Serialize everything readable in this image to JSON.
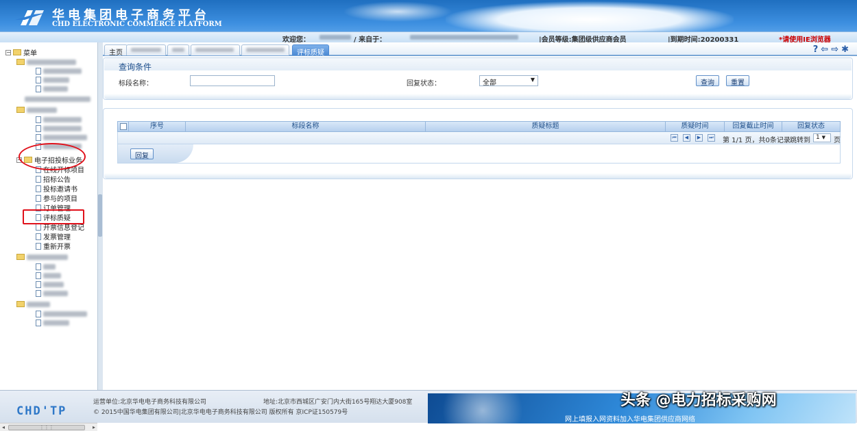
{
  "header": {
    "logo_cn": "华电集团电子商务平台",
    "logo_en": "CHD ELECTRONIC COMMERCE PLATFORM",
    "welcome_label": "欢迎您：",
    "from_label": "/   来自于：",
    "member_level": "|会员等级:集团级供应商会员",
    "expire": "|到期时间:20200331",
    "ie_hint": "*请使用IE浏览器"
  },
  "sidebar": {
    "root_label": "菜单",
    "group_label": "电子招投标业务",
    "items": [
      "在线开标项目",
      "招标公告",
      "投标邀请书",
      "参与的项目",
      "订单管理",
      "评标质疑",
      "开票信息登记",
      "发票管理",
      "重新开票"
    ]
  },
  "tabs": {
    "home": "主页",
    "active": "评标质疑"
  },
  "query": {
    "title": "查询条件",
    "section_label": "标段名称：",
    "section_value": "",
    "reply_status_label": "回复状态：",
    "reply_status_value": "全部",
    "search_button": "查询",
    "reset_button": "重置"
  },
  "grid": {
    "columns": [
      "序号",
      "标段名称",
      "质疑标题",
      "质疑时间",
      "回复截止时间",
      "回复状态"
    ],
    "rows": [],
    "pager": {
      "info": "第 1/1 页，共0条记录",
      "jump_label": "跳转到",
      "page_value": "1",
      "page_suffix": "页"
    },
    "reply_button": "回复"
  },
  "footer": {
    "logo": "CHD'TP",
    "operator": "运营单位:北京华电电子商务科技有限公司",
    "address": "地址:北京市西城区广安门内大街165号翔达大厦908室",
    "copyright": "© 2015中国华电集团有限公司|北京华电电子商务科技有限公司  版权所有  京ICP证150579号",
    "banner_text": "网上填报入网资料加入华电集团供应商网络"
  },
  "watermark": "头条 @电力招标采购网"
}
